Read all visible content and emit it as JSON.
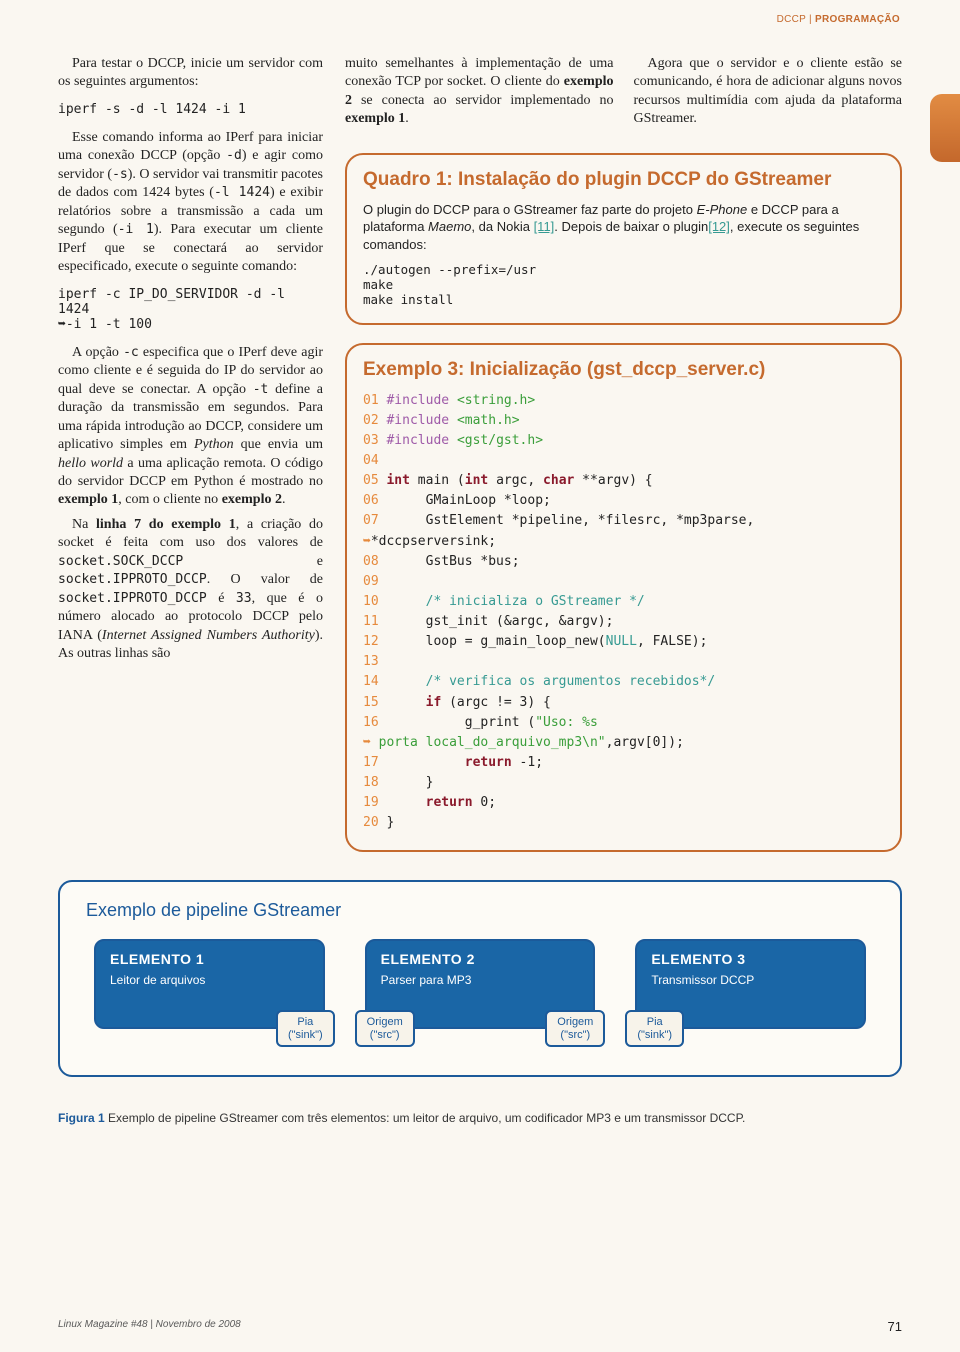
{
  "header": {
    "kicker": "DCCP",
    "section": "PROGRAMAÇÃO"
  },
  "left": {
    "p1a": "Para testar o DCCP, inicie um servidor com os seguintes argumentos:",
    "cmd1": "iperf -s -d -l 1424 -i 1",
    "p1b_a": "Esse comando informa ao IPerf para iniciar uma conexão DCCP (opção ",
    "p1b_code1": "-d",
    "p1b_b": ") e agir como servidor (",
    "p1b_code2": "-s",
    "p1b_c": "). O servidor vai transmitir pacotes de dados com 1424 bytes (",
    "p1b_code3": "-l 1424",
    "p1b_d": ") e exibir relatórios sobre a transmissão a cada um segundo (",
    "p1b_code4": "-i 1",
    "p1b_e": "). Para executar um cliente IPerf que se conectará ao servidor especificado, execute o seguinte comando:",
    "cmd2": "iperf -c IP_DO_SERVIDOR -d -l 1424\n➥-i 1 -t 100",
    "p2a": "A opção ",
    "p2code1": "-c",
    "p2b": " especifica que o IPerf deve agir como cliente e é seguida do IP do servidor ao qual deve se conectar. A opção ",
    "p2code2": "-t",
    "p2c": " define a duração da transmissão em segundos. Para uma rápida introdução ao DCCP, considere um aplicativo simples em ",
    "p2ital1": "Python",
    "p2d": " que envia um ",
    "p2ital2": "hello world",
    "p2e": " a uma aplicação remota. O código do servidor DCCP em Python é mostrado no ",
    "p2bold1": "exemplo 1",
    "p2f": ", com o cliente no ",
    "p2bold2": "exemplo 2",
    "p2g": ".",
    "p3a": "Na ",
    "p3bold1": "linha 7 do exemplo 1",
    "p3b": ", a criação do socket é feita com uso dos valores de ",
    "p3code1": "socket.SOCK_DCCP",
    "p3c": " e ",
    "p3code2": "socket.IPPROTO_DCCP",
    "p3d": ". O valor de ",
    "p3code3": "socket.IPPROTO_DCCP",
    "p3e": " é ",
    "p3code4": "33",
    "p3f": ", que é o número alocado ao protocolo DCCP pelo IANA (",
    "p3ital": "Internet Assigned Numbers Authority",
    "p3g": "). As outras linhas são"
  },
  "mid": {
    "p": "muito semelhantes à implementação de uma conexão TCP por socket. O cliente do ",
    "b1": "exemplo 2",
    "p2": " se conecta ao servidor implementado no ",
    "b2": "exemplo 1",
    "p3": "."
  },
  "right": {
    "p": "Agora que o servidor e o cliente estão se comunicando, é hora de adicionar alguns novos recursos multimídia com ajuda da plataforma GStreamer."
  },
  "quadro1": {
    "title": "Quadro 1: Instalação do plugin DCCP do GStreamer",
    "p1a": "O plugin do DCCP para o GStreamer faz parte do projeto ",
    "p1i1": "E-Phone",
    "p1b": " e DCCP para a plataforma ",
    "p1i2": "Maemo",
    "p1c": ", da Nokia ",
    "link1": "[11]",
    "p1d": ". Depois de baixar o plugin",
    "link2": "[12]",
    "p1e": ", execute os seguintes comandos:",
    "cmds": "./autogen --prefix=/usr\nmake\nmake install"
  },
  "ex3": {
    "title": "Exemplo 3: Inicialização (gst_dccp_server.c)",
    "lines": [
      {
        "n": "01",
        "t": " #include ",
        "s": "<string.h>",
        "kind": "inc"
      },
      {
        "n": "02",
        "t": " #include ",
        "s": "<math.h>",
        "kind": "inc"
      },
      {
        "n": "03",
        "t": " #include ",
        "s": "<gst/gst.h>",
        "kind": "inc"
      },
      {
        "n": "04",
        "t": "",
        "kind": "blank"
      },
      {
        "n": "05",
        "t": " int main (int argc, char **argv) {",
        "kind": "sig"
      },
      {
        "n": "06",
        "t": "      GMainLoop *loop;",
        "kind": "plain"
      },
      {
        "n": "07",
        "t": "      GstElement *pipeline, *filesrc, *mp3parse,",
        "kind": "plain"
      },
      {
        "n": "➥",
        "t": "*dccpserversink;",
        "kind": "wrap"
      },
      {
        "n": "08",
        "t": "      GstBus *bus;",
        "kind": "plain"
      },
      {
        "n": "09",
        "t": "",
        "kind": "blank"
      },
      {
        "n": "10",
        "t": "      /* inicializa o GStreamer */",
        "kind": "cmt"
      },
      {
        "n": "11",
        "t": "      gst_init (&argc, &argv);",
        "kind": "plain"
      },
      {
        "n": "12",
        "t": "      loop = g_main_loop_new(NULL, FALSE);",
        "kind": "null"
      },
      {
        "n": "13",
        "t": "",
        "kind": "blank"
      },
      {
        "n": "14",
        "t": "      /* verifica os argumentos recebidos*/",
        "kind": "cmt"
      },
      {
        "n": "15",
        "t": "      if (argc != 3) {",
        "kind": "kw_if"
      },
      {
        "n": "16",
        "t": "           g_print (\"Uso: %s",
        "kind": "str"
      },
      {
        "n": "➥",
        "t": " porta local_do_arquivo_mp3\\n\",argv[0]);",
        "kind": "wrapstr"
      },
      {
        "n": "17",
        "t": "           return -1;",
        "kind": "kw_ret"
      },
      {
        "n": "18",
        "t": "      }",
        "kind": "plain"
      },
      {
        "n": "19",
        "t": "      return 0;",
        "kind": "kw_ret"
      },
      {
        "n": "20",
        "t": " }",
        "kind": "plain"
      }
    ]
  },
  "figure": {
    "title": "Exemplo de pipeline GStreamer",
    "elems": [
      {
        "name": "ELEMENTO 1",
        "sub": "Leitor de arquivos",
        "ports": [
          {
            "side": "right",
            "label": "Pia\n(\"sink\")"
          }
        ]
      },
      {
        "name": "ELEMENTO 2",
        "sub": "Parser para MP3",
        "ports": [
          {
            "side": "left",
            "label": "Origem\n(\"src\")"
          },
          {
            "side": "right",
            "label": "Origem\n(\"src\")"
          }
        ]
      },
      {
        "name": "ELEMENTO 3",
        "sub": "Transmissor DCCP",
        "ports": [
          {
            "side": "left",
            "label": "Pia\n(\"sink\")"
          }
        ]
      }
    ],
    "caption_bold": "Figura 1",
    "caption": " Exemplo de pipeline GStreamer com três elementos: um leitor de arquivo, um codificador MP3 e um transmissor DCCP."
  },
  "footer": {
    "left": "Linux Magazine #48 | Novembro de 2008",
    "page": "71"
  }
}
